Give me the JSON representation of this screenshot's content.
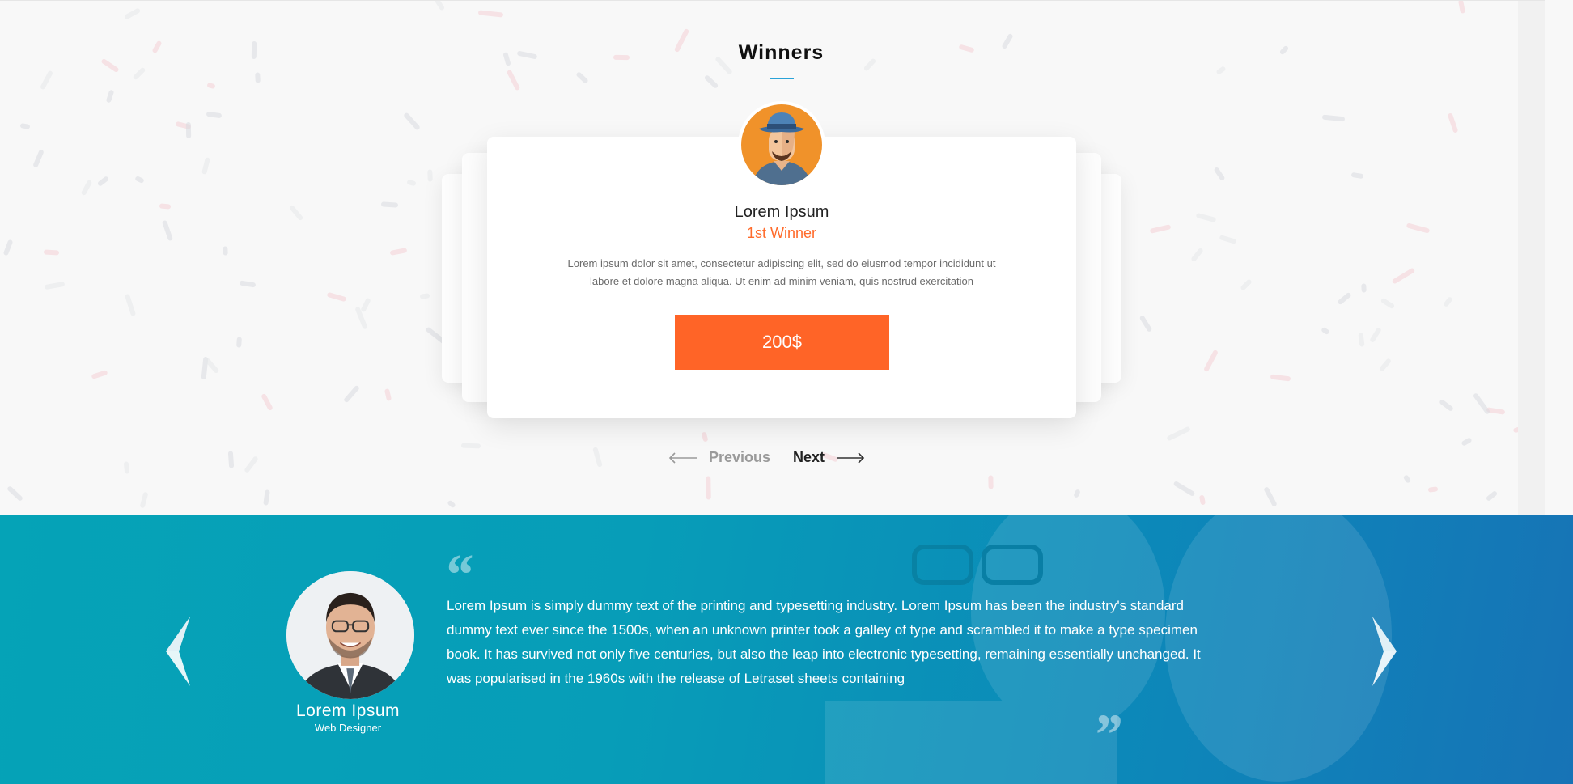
{
  "winners": {
    "title": "Winners",
    "card": {
      "name": "Lorem Ipsum",
      "rank": "1st Winner",
      "description": "Lorem ipsum dolor sit amet, consectetur adipiscing elit, sed do eiusmod tempor incididunt ut labore et dolore magna aliqua. Ut enim ad minim veniam, quis nostrud exercitation",
      "prize": "200$",
      "avatar_icon": "hat-man-avatar-icon"
    },
    "nav": {
      "previous": "Previous",
      "next": "Next"
    }
  },
  "testimonial": {
    "name": "Lorem Ipsum",
    "role": "Web Designer",
    "quote": "Lorem Ipsum is simply dummy text of the printing and typesetting industry. Lorem Ipsum has been the industry's standard dummy text ever since the 1500s, when an unknown printer took a galley of type and scrambled it to make a type specimen book. It has survived not only five centuries, but also the leap into electronic typesetting, remaining essentially unchanged. It was popularised in the 1960s with the release of Letraset sheets containing",
    "open_quote_mark": "“",
    "close_quote_mark": "”"
  },
  "colors": {
    "accent_orange": "#ff6427",
    "title_underline": "#2aa3d8",
    "testimonial_bg_start": "#05a3b7",
    "testimonial_bg_end": "#1773b6"
  }
}
